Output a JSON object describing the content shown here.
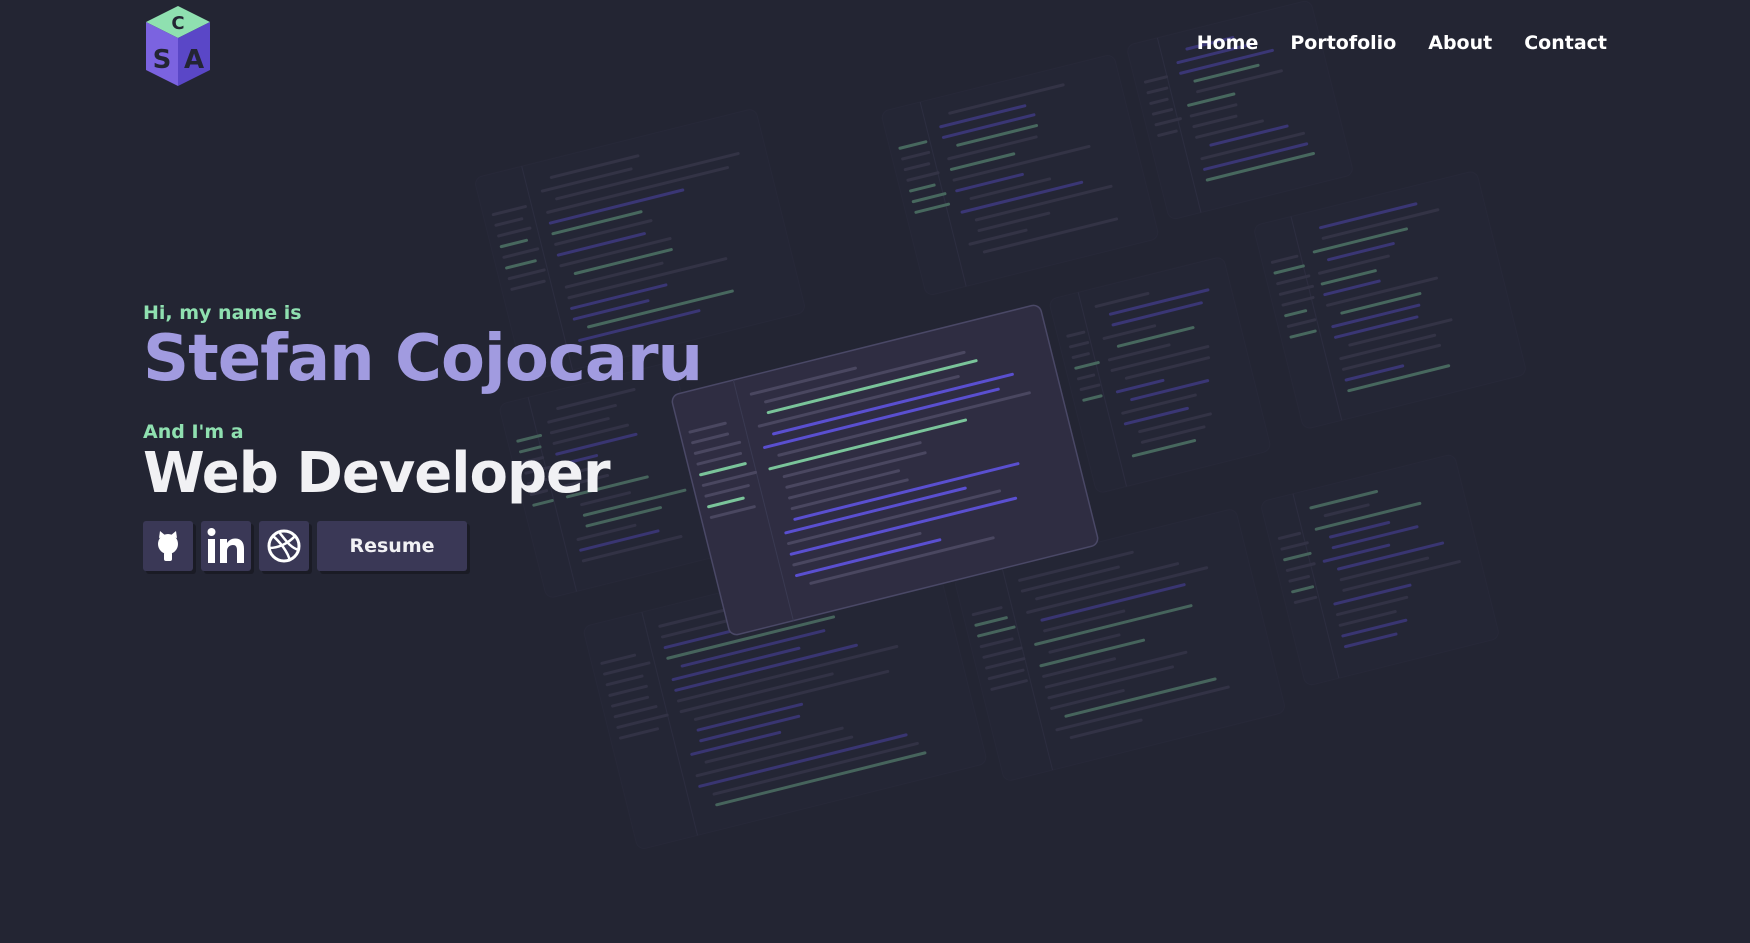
{
  "nav": {
    "items": [
      "Home",
      "Portofolio",
      "About",
      "Contact"
    ]
  },
  "hero": {
    "greeting": "Hi, my name is",
    "name": "Stefan Cojocaru",
    "role_prefix": "And I'm a",
    "role": "Web Developer",
    "resume_label": "Resume",
    "social_icons": [
      "github-icon",
      "linkedin-icon",
      "dribbble-icon"
    ]
  },
  "colors": {
    "background": "#232533",
    "accent_purple": "#a19be0",
    "accent_green": "#8fe0b0",
    "button_bg": "#3a3856",
    "text": "#f1f1f4"
  }
}
